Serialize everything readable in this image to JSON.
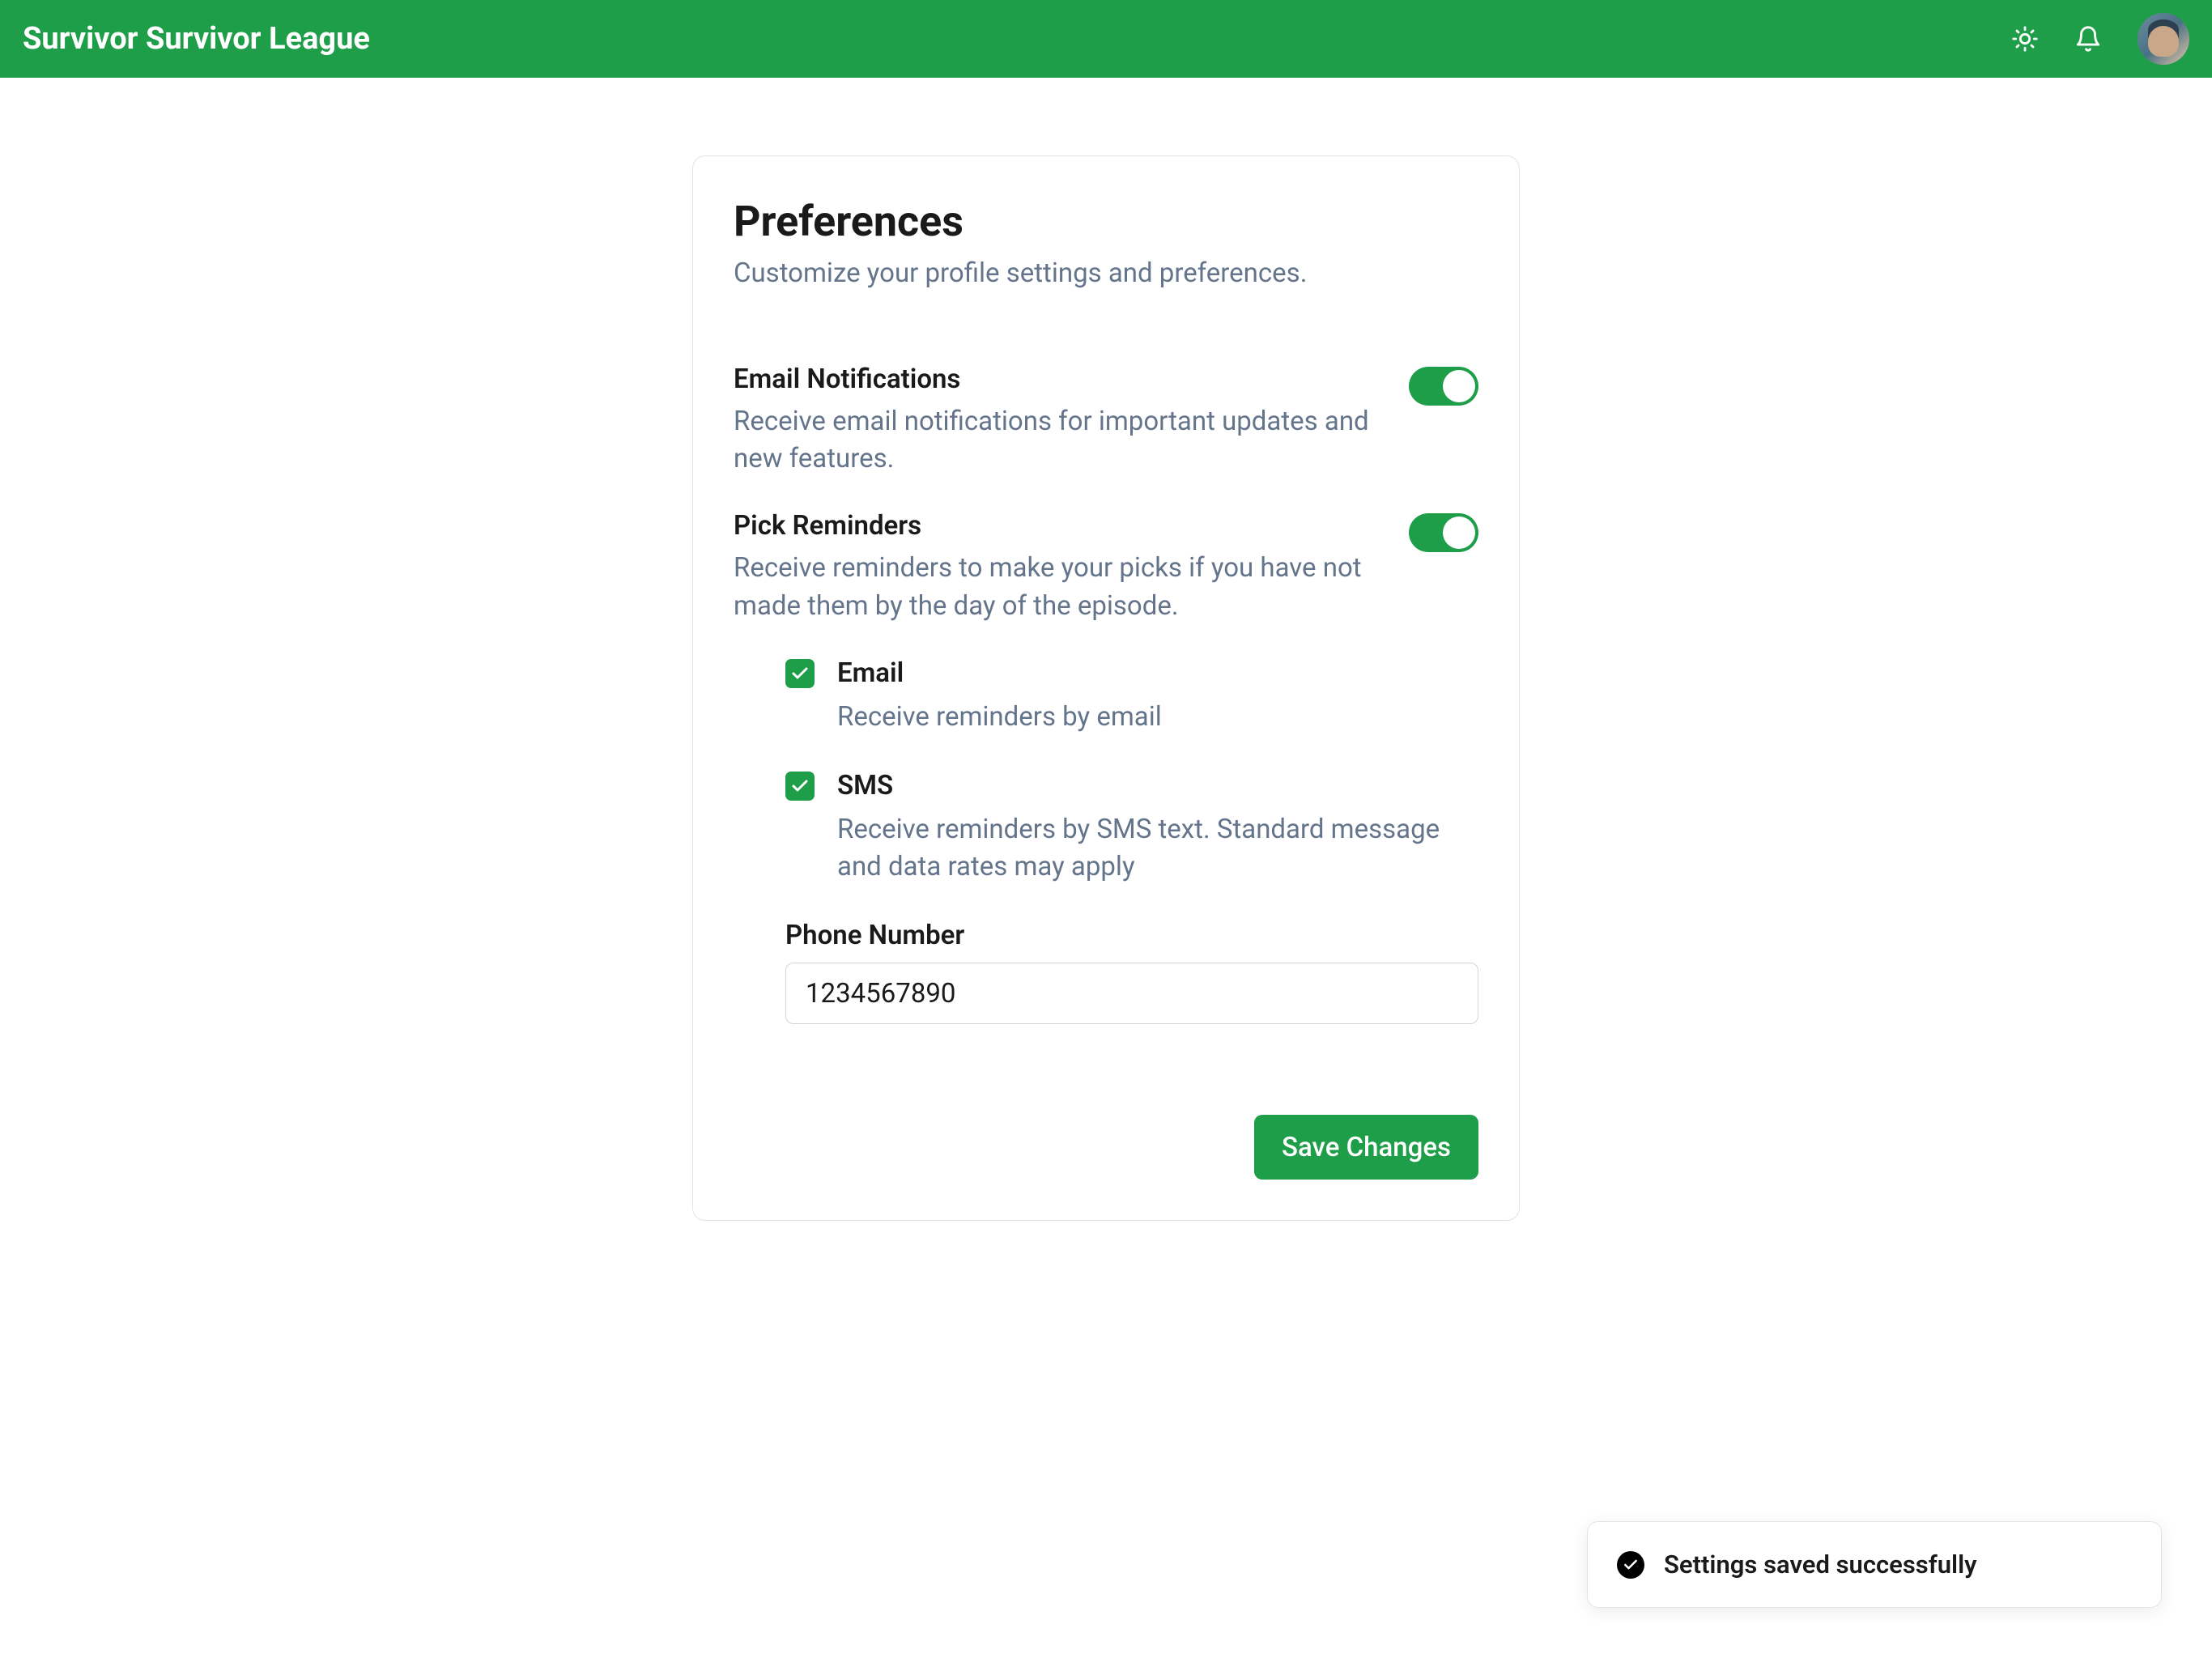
{
  "header": {
    "title": "Survivor Survivor League"
  },
  "card": {
    "title": "Preferences",
    "subtitle": "Customize your profile settings and preferences.",
    "emailNotifications": {
      "label": "Email Notifications",
      "description": "Receive email notifications for important updates and new features.",
      "enabled": true
    },
    "pickReminders": {
      "label": "Pick Reminders",
      "description": "Receive reminders to make your picks if you have not made them by the day of the episode.",
      "enabled": true,
      "email": {
        "label": "Email",
        "description": "Receive reminders by email",
        "checked": true
      },
      "sms": {
        "label": "SMS",
        "description": "Receive reminders by SMS text. Standard message and data rates may apply",
        "checked": true
      },
      "phoneNumber": {
        "label": "Phone Number",
        "value": "1234567890"
      }
    },
    "saveButton": "Save Changes"
  },
  "toast": {
    "message": "Settings saved successfully"
  }
}
